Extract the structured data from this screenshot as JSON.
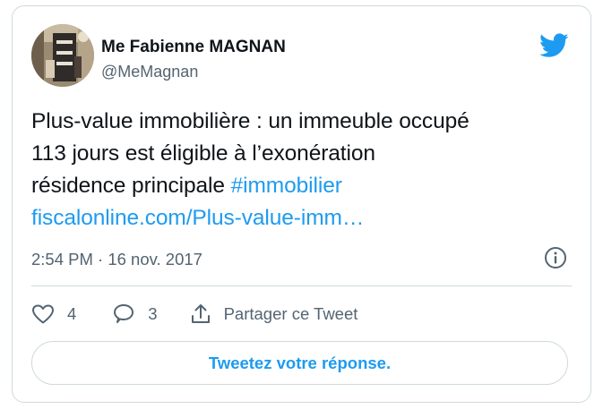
{
  "author": {
    "display_name": "Me Fabienne MAGNAN",
    "handle": "@MeMagnan"
  },
  "tweet": {
    "text_line1": "Plus-value immobilière : un immeuble occupé",
    "text_line2": "113 jours est éligible à l’exonération",
    "text_line3_plain": "résidence principale",
    "hashtag": "#immobilier",
    "link": "fiscalonline.com/Plus-value-imm…"
  },
  "meta": {
    "timestamp": "2:54 PM · 16 nov. 2017"
  },
  "actions": {
    "like_count": "4",
    "reply_count": "3",
    "share_label": "Partager ce Tweet"
  },
  "reply_button": {
    "label": "Tweetez votre réponse."
  },
  "icons": {
    "brand": "twitter-bird-icon",
    "info": "info-icon",
    "like": "heart-icon",
    "reply": "comment-icon",
    "share": "share-icon"
  },
  "colors": {
    "accent": "#1d9bf0",
    "text": "#0f1419",
    "muted": "#536471",
    "border": "#cfd9de"
  }
}
